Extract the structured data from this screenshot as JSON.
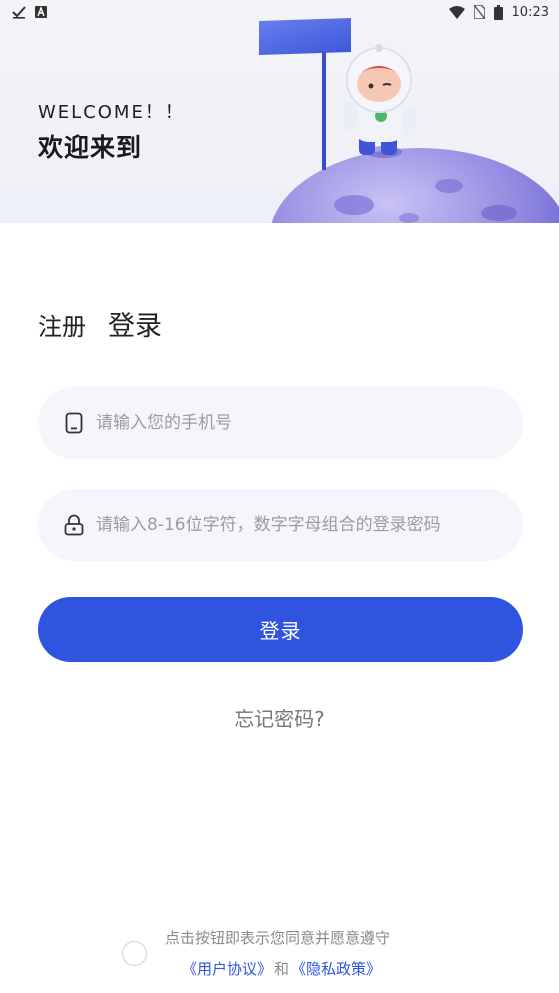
{
  "status_bar": {
    "time": "10:23",
    "left_icons": [
      "check-notification-icon",
      "a-notification-icon"
    ],
    "right_icons": [
      "wifi-icon",
      "no-sim-icon",
      "battery-icon"
    ]
  },
  "hero": {
    "welcome": "WELCOME！！",
    "welcome_cn": "欢迎来到",
    "illustration": "astronaut-on-planet-with-flag"
  },
  "tabs": [
    {
      "label": "注册",
      "active": false
    },
    {
      "label": "登录",
      "active": true
    }
  ],
  "form": {
    "phone_placeholder": "请输入您的手机号",
    "phone_icon": "phone-icon",
    "password_placeholder": "请输入8-16位字符，数字字母组合的登录密码",
    "password_icon": "lock-icon"
  },
  "login_button": "登录",
  "forgot_password": "忘记密码?",
  "agreement": {
    "line1": "点击按钮即表示您同意并愿意遵守",
    "user_agreement": "《用户协议》",
    "and": "和",
    "privacy_policy": "《隐私政策》"
  },
  "colors": {
    "primary": "#2f55e0",
    "field_bg": "#f4f6fb",
    "hero_bg": "#f3f4f8"
  }
}
